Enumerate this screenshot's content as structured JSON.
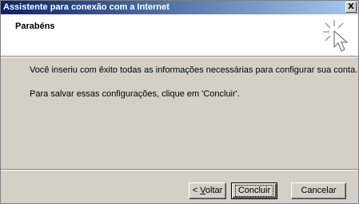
{
  "window": {
    "title": "Assistente para conexão com a Internet",
    "close_label": "X"
  },
  "header": {
    "heading": "Parabéns"
  },
  "content": {
    "line1": "Você inseriu com êxito todas as informações necessárias para configurar sua conta.",
    "line2": "Para salvar essas configurações, clique em 'Concluir'."
  },
  "buttons": {
    "back_mnemonic": "< ",
    "back_underlined": "V",
    "back_rest": "oltar",
    "finish_label": "Concluir",
    "cancel_label": "Cancelar"
  }
}
